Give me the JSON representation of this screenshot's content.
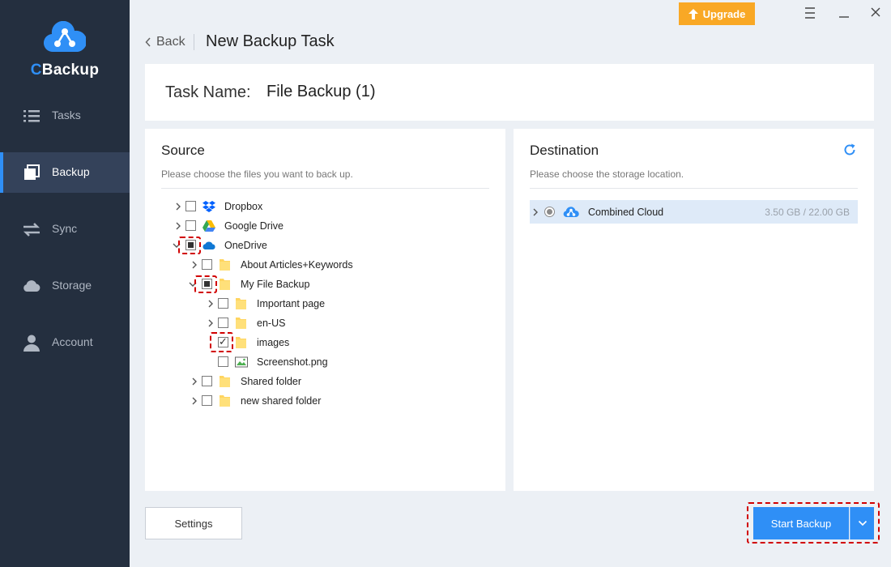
{
  "app": {
    "logo_prefix": "C",
    "logo_suffix": "Backup",
    "upgrade_label": "Upgrade"
  },
  "sidebar": {
    "items": [
      {
        "label": "Tasks",
        "icon": "list-icon"
      },
      {
        "label": "Backup",
        "icon": "backup-icon",
        "active": true
      },
      {
        "label": "Sync",
        "icon": "sync-icon"
      },
      {
        "label": "Storage",
        "icon": "cloud-icon"
      },
      {
        "label": "Account",
        "icon": "user-icon"
      }
    ]
  },
  "header": {
    "back_label": "Back",
    "title": "New Backup Task"
  },
  "task": {
    "label": "Task Name:",
    "value": "File Backup (1)"
  },
  "source": {
    "title": "Source",
    "description": "Please choose the files you want to back up.",
    "tree": [
      {
        "label": "Dropbox",
        "state": "unchecked",
        "icon": "dropbox-icon",
        "expanded": false
      },
      {
        "label": "Google Drive",
        "state": "unchecked",
        "icon": "google-drive-icon",
        "expanded": false
      },
      {
        "label": "OneDrive",
        "state": "partial",
        "icon": "onedrive-icon",
        "expanded": true
      },
      {
        "label": "About Articles+Keywords",
        "state": "unchecked",
        "icon": "folder-icon",
        "expanded": false
      },
      {
        "label": "My File Backup",
        "state": "partial",
        "icon": "folder-icon",
        "expanded": true
      },
      {
        "label": "Important page",
        "state": "unchecked",
        "icon": "folder-icon",
        "expanded": false
      },
      {
        "label": "en-US",
        "state": "unchecked",
        "icon": "folder-icon",
        "expanded": false
      },
      {
        "label": "images",
        "state": "checked",
        "icon": "folder-icon",
        "expanded": false
      },
      {
        "label": "Screenshot.png",
        "state": "unchecked",
        "icon": "image-file-icon"
      },
      {
        "label": "Shared folder",
        "state": "unchecked",
        "icon": "folder-icon",
        "expanded": false
      },
      {
        "label": "new shared folder",
        "state": "unchecked",
        "icon": "folder-icon",
        "expanded": false
      }
    ]
  },
  "destination": {
    "title": "Destination",
    "description": "Please choose the storage location.",
    "items": [
      {
        "name": "Combined Cloud",
        "size": "3.50 GB / 22.00 GB",
        "selected": true
      }
    ]
  },
  "footer": {
    "settings_label": "Settings",
    "start_label": "Start Backup"
  },
  "colors": {
    "sidebar_bg": "#242f3f",
    "accent": "#2f8ff6",
    "upgrade": "#f9a825",
    "highlight": "#d10000"
  }
}
